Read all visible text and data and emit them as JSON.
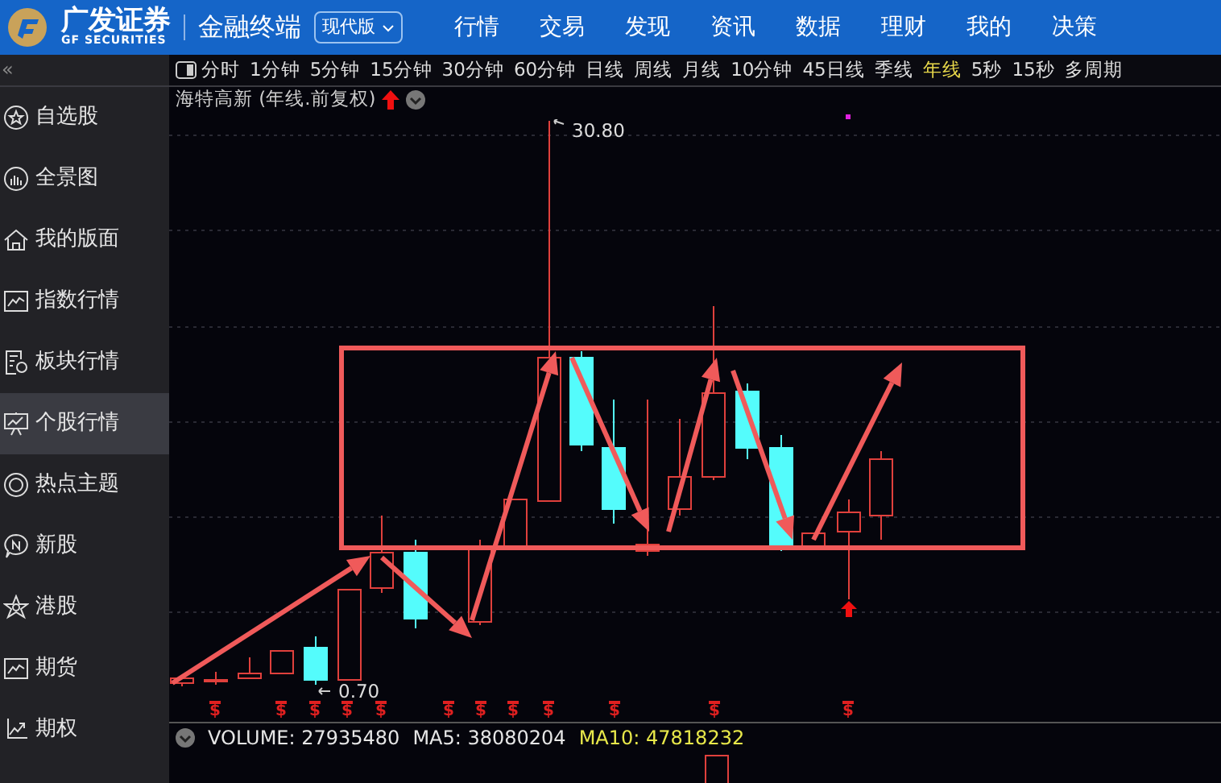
{
  "header": {
    "brand": "广发证券",
    "brand_sub": "GF SECURITIES",
    "product": "金融终端",
    "edition": "现代版",
    "nav": [
      "行情",
      "交易",
      "发现",
      "资讯",
      "数据",
      "理财",
      "我的",
      "决策"
    ]
  },
  "sidebar": {
    "collapse": "«",
    "items": [
      {
        "label": "自选股",
        "selected": false
      },
      {
        "label": "全景图",
        "selected": false
      },
      {
        "label": "我的版面",
        "selected": false
      },
      {
        "label": "指数行情",
        "selected": false
      },
      {
        "label": "板块行情",
        "selected": false
      },
      {
        "label": "个股行情",
        "selected": true
      },
      {
        "label": "热点主题",
        "selected": false
      },
      {
        "label": "新股",
        "selected": false
      },
      {
        "label": "港股",
        "selected": false
      },
      {
        "label": "期货",
        "selected": false
      },
      {
        "label": "期权",
        "selected": false
      }
    ]
  },
  "periods": [
    {
      "label": "分时",
      "selected": false
    },
    {
      "label": "1分钟",
      "selected": false
    },
    {
      "label": "5分钟",
      "selected": false
    },
    {
      "label": "15分钟",
      "selected": false
    },
    {
      "label": "30分钟",
      "selected": false
    },
    {
      "label": "60分钟",
      "selected": false
    },
    {
      "label": "日线",
      "selected": false
    },
    {
      "label": "周线",
      "selected": false
    },
    {
      "label": "月线",
      "selected": false
    },
    {
      "label": "10分钟",
      "selected": false
    },
    {
      "label": "45日线",
      "selected": false
    },
    {
      "label": "季线",
      "selected": false
    },
    {
      "label": "年线",
      "selected": true
    },
    {
      "label": "5秒",
      "selected": false
    },
    {
      "label": "15秒",
      "selected": false
    },
    {
      "label": "多周期",
      "selected": false
    }
  ],
  "chart": {
    "title": "海特高新 (年线.前复权)",
    "high_label": "30.80",
    "low_label": "0.70",
    "event_marks": [
      "$",
      "$",
      "$",
      "$",
      "$",
      "$",
      "$",
      "$",
      "$",
      "$",
      "$",
      "$"
    ]
  },
  "volume": {
    "volume": "VOLUME: 27935480",
    "ma5": "MA5: 38080204",
    "ma10": "MA10: 47818232"
  }
}
